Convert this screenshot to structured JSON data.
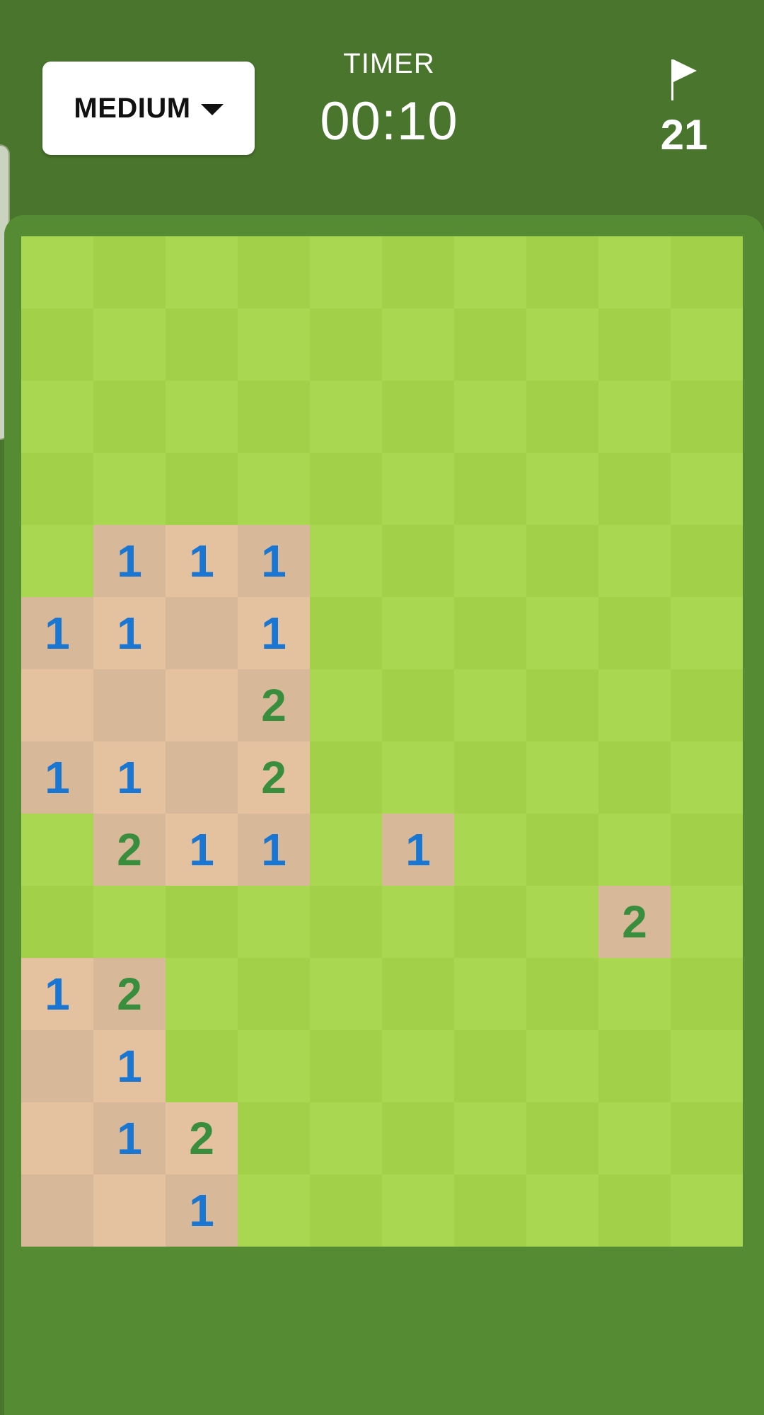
{
  "header": {
    "difficulty_label": "MEDIUM",
    "timer_label": "TIMER",
    "timer_value": "00:10",
    "flags_remaining": "21"
  },
  "colors": {
    "header_bg": "#4a752c",
    "board_bg": "#558b33",
    "hidden_light": "#aad751",
    "hidden_dark": "#a2d149",
    "revealed_light": "#e5c29f",
    "revealed_dark": "#d7b899",
    "number_1": "#1976d2",
    "number_2": "#388e3c"
  },
  "icons": {
    "flag": "flag-icon",
    "dropdown": "chevron-down-icon"
  },
  "board": {
    "columns": 10,
    "rows_count": 14,
    "legend": "H = hidden tile, 0 = revealed empty, digit = revealed count",
    "rows": [
      [
        "H",
        "H",
        "H",
        "H",
        "H",
        "H",
        "H",
        "H",
        "H",
        "H"
      ],
      [
        "H",
        "H",
        "H",
        "H",
        "H",
        "H",
        "H",
        "H",
        "H",
        "H"
      ],
      [
        "H",
        "H",
        "H",
        "H",
        "H",
        "H",
        "H",
        "H",
        "H",
        "H"
      ],
      [
        "H",
        "H",
        "H",
        "H",
        "H",
        "H",
        "H",
        "H",
        "H",
        "H"
      ],
      [
        "H",
        "1",
        "1",
        "1",
        "H",
        "H",
        "H",
        "H",
        "H",
        "H"
      ],
      [
        "1",
        "1",
        "0",
        "1",
        "H",
        "H",
        "H",
        "H",
        "H",
        "H"
      ],
      [
        "0",
        "0",
        "0",
        "2",
        "H",
        "H",
        "H",
        "H",
        "H",
        "H"
      ],
      [
        "1",
        "1",
        "0",
        "2",
        "H",
        "H",
        "H",
        "H",
        "H",
        "H"
      ],
      [
        "H",
        "2",
        "1",
        "1",
        "H",
        "1",
        "H",
        "H",
        "H",
        "H"
      ],
      [
        "H",
        "H",
        "H",
        "H",
        "H",
        "H",
        "H",
        "H",
        "2",
        "H"
      ],
      [
        "1",
        "2",
        "H",
        "H",
        "H",
        "H",
        "H",
        "H",
        "H",
        "H"
      ],
      [
        "0",
        "1",
        "H",
        "H",
        "H",
        "H",
        "H",
        "H",
        "H",
        "H"
      ],
      [
        "0",
        "1",
        "2",
        "H",
        "H",
        "H",
        "H",
        "H",
        "H",
        "H"
      ],
      [
        "0",
        "0",
        "1",
        "H",
        "H",
        "H",
        "H",
        "H",
        "H",
        "H"
      ]
    ]
  }
}
